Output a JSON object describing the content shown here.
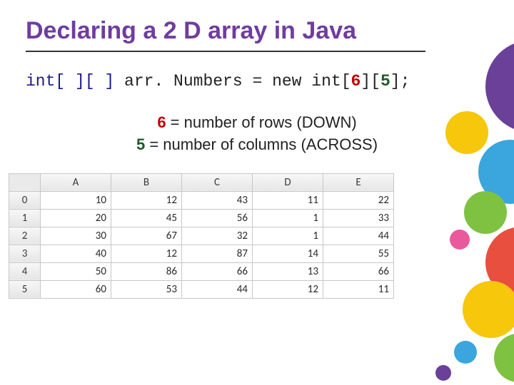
{
  "title": "Declaring a 2 D array in Java",
  "code": {
    "prefix": "int[ ][ ] ",
    "name": "arr. Numbers",
    "assign": " = new int",
    "open1": "[",
    "rows": "6",
    "close1": "]",
    "open2": "[",
    "cols": "5",
    "close2": "]",
    "semi": ";"
  },
  "explain": {
    "six": "6",
    "rows_text": " = number of rows (DOWN)",
    "five": "5",
    "cols_text": " = number of columns (ACROSS)"
  },
  "table": {
    "headers": [
      "",
      "A",
      "B",
      "C",
      "D",
      "E"
    ],
    "rows": [
      {
        "h": "0",
        "cells": [
          "10",
          "12",
          "43",
          "11",
          "22"
        ]
      },
      {
        "h": "1",
        "cells": [
          "20",
          "45",
          "56",
          "1",
          "33"
        ]
      },
      {
        "h": "2",
        "cells": [
          "30",
          "67",
          "32",
          "1",
          "44"
        ]
      },
      {
        "h": "3",
        "cells": [
          "40",
          "12",
          "87",
          "14",
          "55"
        ]
      },
      {
        "h": "4",
        "cells": [
          "50",
          "86",
          "66",
          "13",
          "66"
        ]
      },
      {
        "h": "5",
        "cells": [
          "60",
          "53",
          "44",
          "12",
          "11"
        ]
      }
    ]
  }
}
